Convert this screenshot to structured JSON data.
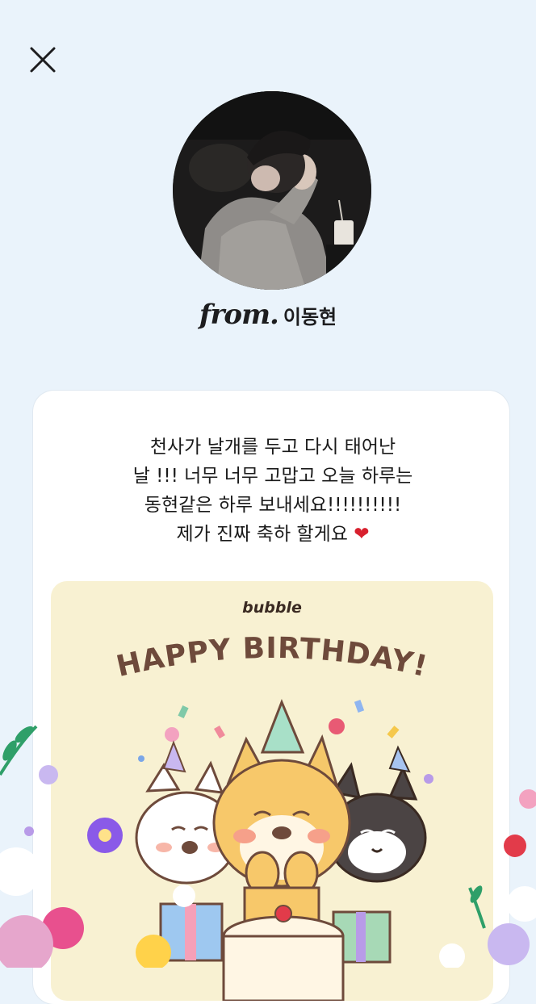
{
  "from": {
    "label": "from.",
    "name": "이동현"
  },
  "message": {
    "lines": [
      "천사가 날개를 두고 다시 태어난",
      "날 !!! 너무 너무 고맙고 오늘 하루는",
      "동현같은 하루 보내세요!!!!!!!!!!",
      "제가 진짜 축하 할게요"
    ],
    "heart": "❤"
  },
  "card": {
    "brand": "bubble",
    "headline": "HAPPY BIRTHDAY!"
  },
  "colors": {
    "background": "#eaf3fb",
    "card": "#ffffff",
    "card_inner": "#f8f1d2",
    "headline": "#6e4a3b",
    "heart": "#d8202e"
  },
  "icons": {
    "close": "close-icon",
    "avatar": "avatar-photo",
    "heart": "heart-icon"
  }
}
